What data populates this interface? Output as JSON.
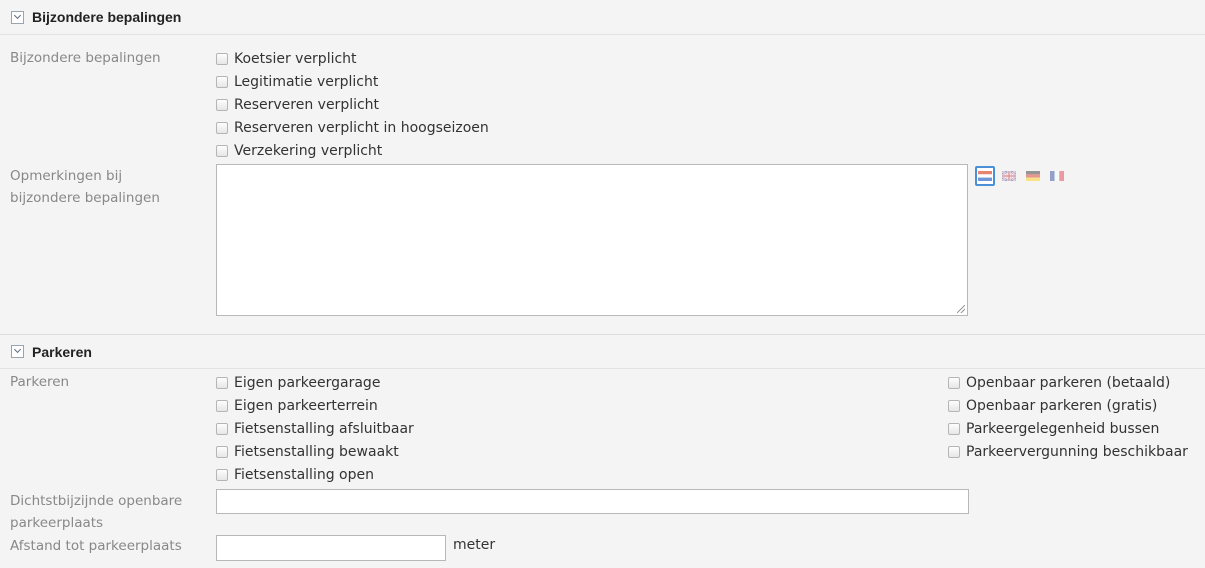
{
  "sections": {
    "bijzondere": {
      "title": "Bijzondere bepalingen",
      "field_label": "Bijzondere bepalingen",
      "checkboxes": [
        "Koetsier verplicht",
        "Legitimatie verplicht",
        "Reserveren verplicht",
        "Reserveren verplicht in hoogseizoen",
        "Verzekering verplicht"
      ],
      "remarks_label": "Opmerkingen bij bijzondere bepalingen",
      "remarks_value": "",
      "languages": [
        {
          "name": "nl-flag-icon",
          "active": true
        },
        {
          "name": "en-flag-icon",
          "active": false
        },
        {
          "name": "de-flag-icon",
          "active": false
        },
        {
          "name": "fr-flag-icon",
          "active": false
        }
      ]
    },
    "parkeren": {
      "title": "Parkeren",
      "field_label": "Parkeren",
      "checkboxes_left": [
        "Eigen parkeergarage",
        "Eigen parkeerterrein",
        "Fietsenstalling afsluitbaar",
        "Fietsenstalling bewaakt",
        "Fietsenstalling open"
      ],
      "checkboxes_right": [
        "Openbaar parkeren (betaald)",
        "Openbaar parkeren (gratis)",
        "Parkeergelegenheid bussen",
        "Parkeervergunning beschikbaar"
      ],
      "nearest_label": "Dichtstbijzijnde openbare parkeerplaats",
      "nearest_value": "",
      "distance_label": "Afstand tot parkeerplaats",
      "distance_value": "",
      "distance_unit": "meter"
    }
  }
}
